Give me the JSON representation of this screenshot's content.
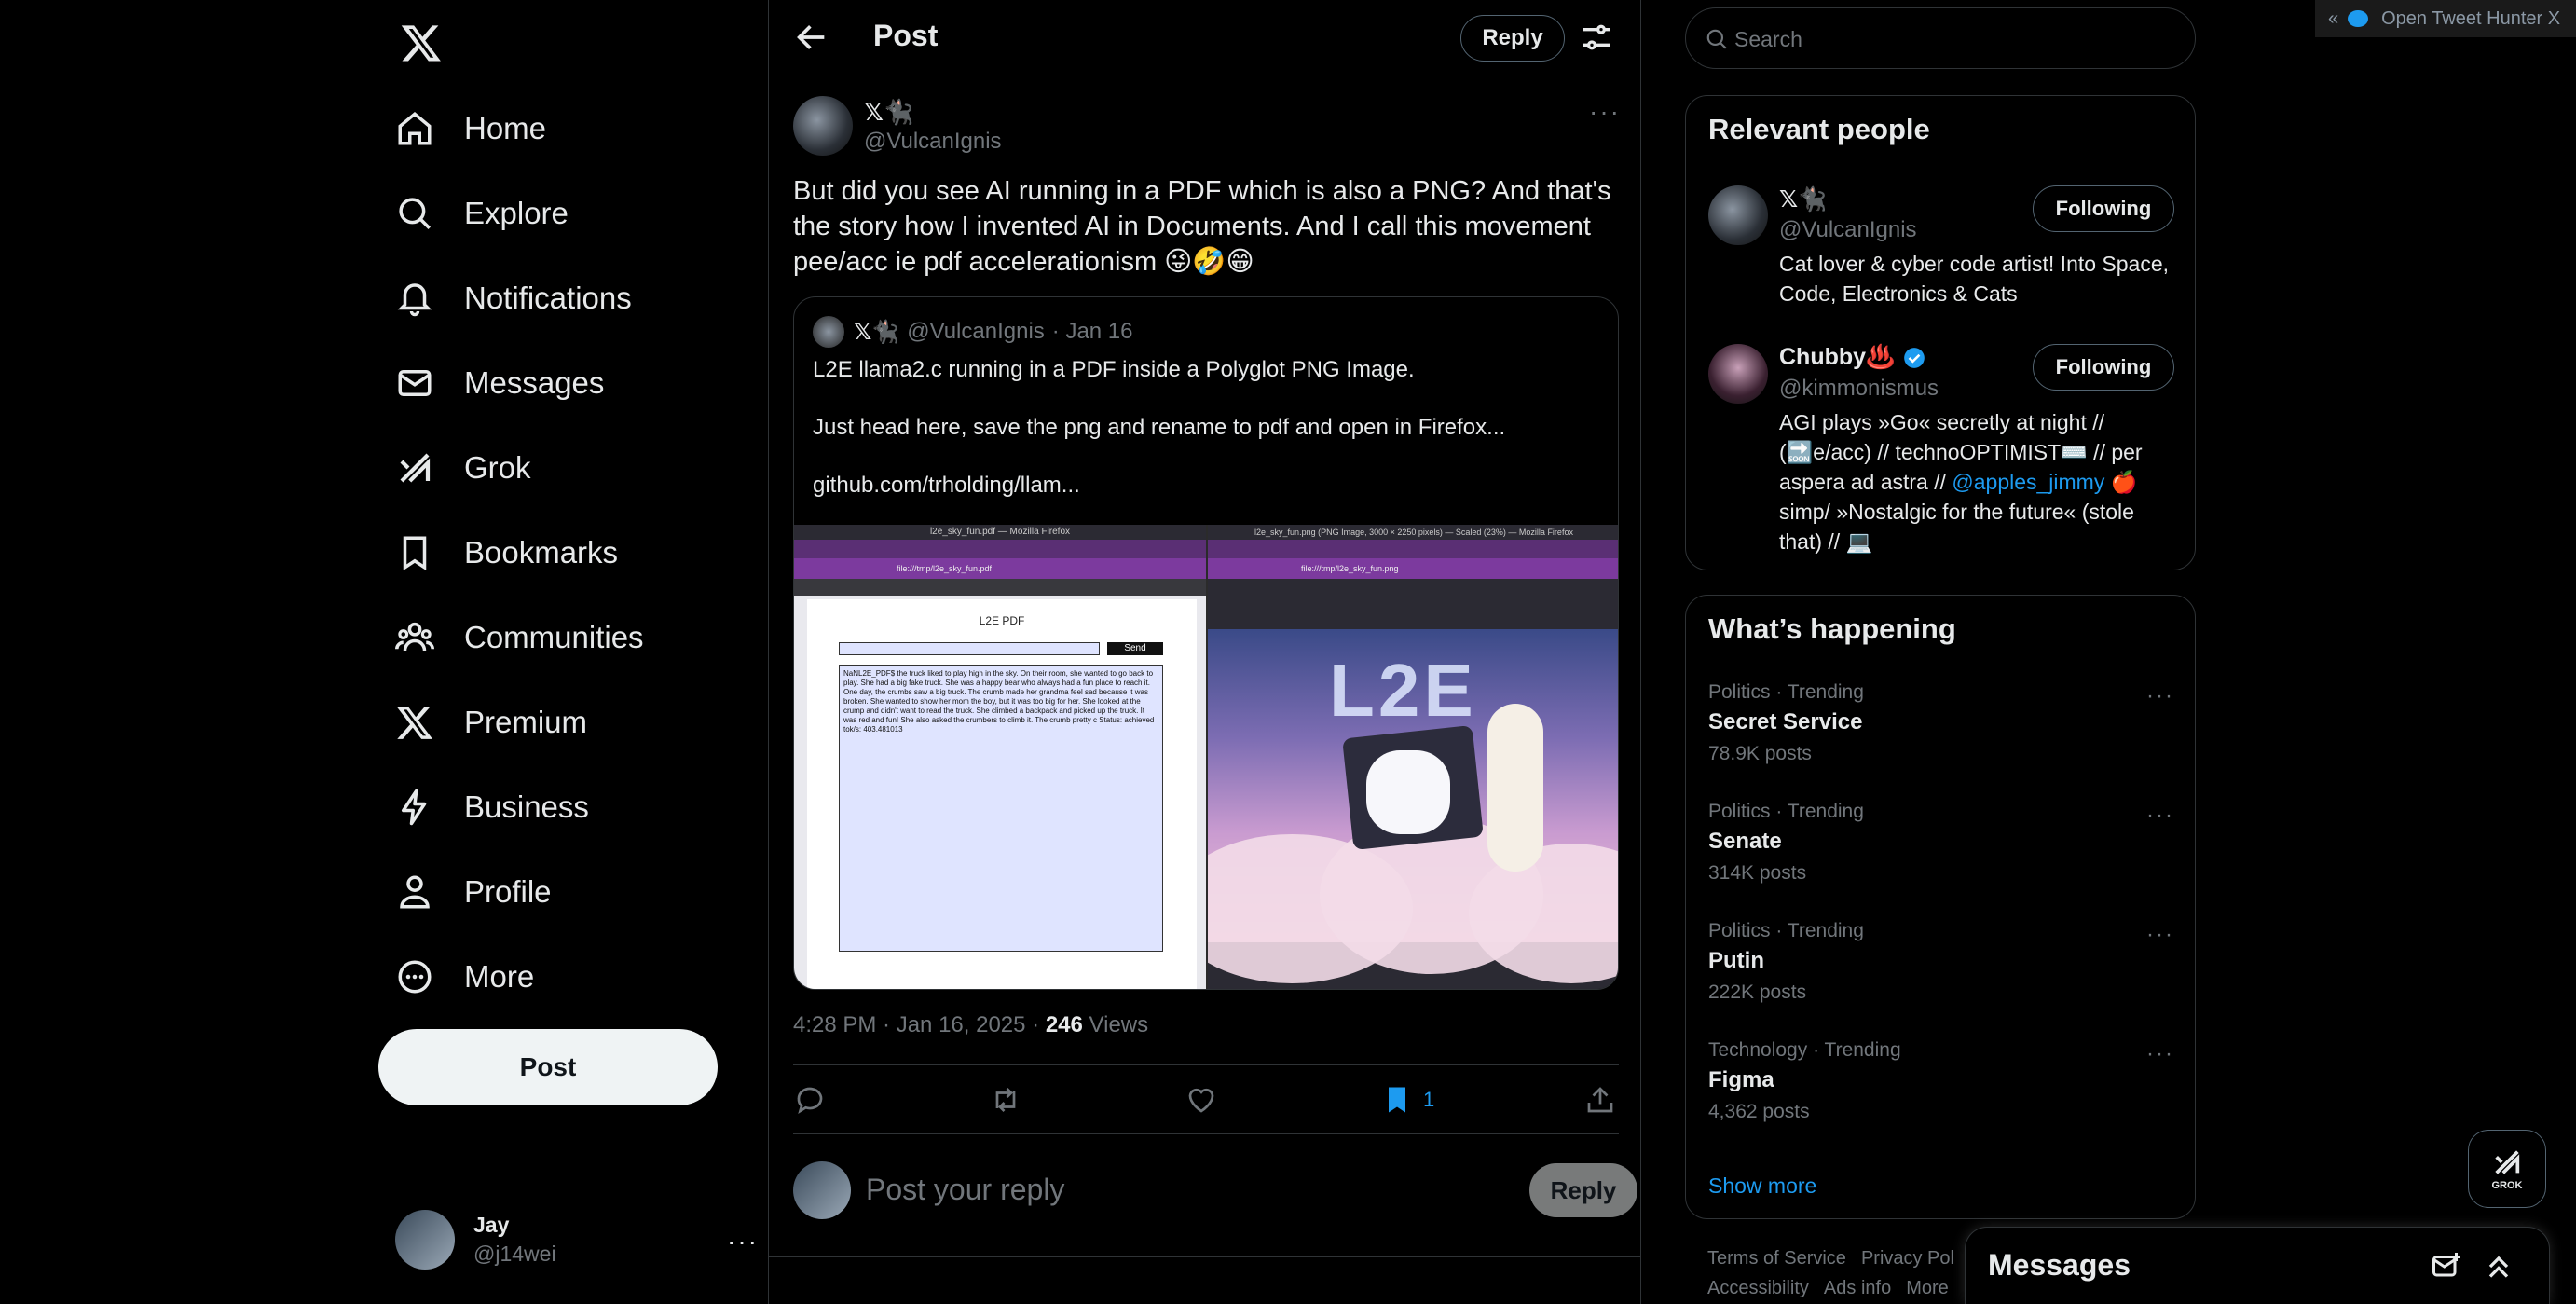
{
  "nav": {
    "items": [
      {
        "label": "Home",
        "icon": "home-icon"
      },
      {
        "label": "Explore",
        "icon": "search-icon"
      },
      {
        "label": "Notifications",
        "icon": "bell-icon"
      },
      {
        "label": "Messages",
        "icon": "mail-icon"
      },
      {
        "label": "Grok",
        "icon": "grok-icon"
      },
      {
        "label": "Bookmarks",
        "icon": "bookmark-icon"
      },
      {
        "label": "Communities",
        "icon": "communities-icon"
      },
      {
        "label": "Premium",
        "icon": "x-icon"
      },
      {
        "label": "Business",
        "icon": "lightning-icon"
      },
      {
        "label": "Profile",
        "icon": "person-icon"
      },
      {
        "label": "More",
        "icon": "more-circle-icon"
      }
    ],
    "post_label": "Post"
  },
  "account": {
    "name": "Jay",
    "handle": "@j14wei"
  },
  "header": {
    "title": "Post",
    "reply_label": "Reply"
  },
  "tweet": {
    "author_name": "𝕏🐈‍⬛",
    "author_handle": "@VulcanIgnis",
    "text": "But did you see AI running in a PDF which is also a PNG? And that's the story how I invented AI in Documents. And I call this movement pee/acc ie pdf accelerationism 😜🤣😁",
    "quote": {
      "author_name": "𝕏🐈‍⬛",
      "author_handle": "@VulcanIgnis",
      "date": "· Jan 16",
      "text": "L2E llama2.c running in a PDF inside a Polyglot PNG Image.\n\nJust head here, save the png and rename to pdf and open in Firefox...\n\ngithub.com/trholding/llam...",
      "media_left": {
        "window_title": "l2e_sky_fun.pdf — Mozilla Firefox",
        "url": "file:///tmp/l2e_sky_fun.pdf",
        "pdf_title": "L2E PDF",
        "send_label": "Send",
        "output": "NaNL2E_PDF$ the truck liked to play high in the sky. On their room, she wanted to go back to play. She had a big fake truck. She was a happy bear who always had a fun place to reach it. One day, the crumbs saw a big truck. The crumb made her grandma feel sad because it was broken. She wanted to show her mom the boy, but it was too big for her. She looked at the crump and didn't want to read the truck. She climbed a backpack and picked up the truck. It was red and fun! She also asked the crumbers to climb it. The crumb pretty c Status: achieved tok/s: 403.481013"
      },
      "media_right": {
        "window_title": "l2e_sky_fun.png (PNG Image, 3000 × 2250 pixels) — Scaled (23%) — Mozilla Firefox",
        "url": "file:///tmp/l2e_sky_fun.png",
        "image_text": "L2E"
      }
    },
    "time": "4:28 PM · Jan 16, 2025 · ",
    "views_count": "246",
    "views_label": " Views",
    "bookmark_count": "1",
    "reply_placeholder": "Post your reply",
    "reply_button": "Reply"
  },
  "sidebar": {
    "search_placeholder": "Search",
    "relevant_title": "Relevant people",
    "people": [
      {
        "name": "𝕏🐈‍⬛",
        "handle": "@VulcanIgnis",
        "bio": "Cat lover & cyber code artist! Into Space, Code, Electronics & Cats",
        "follow": "Following"
      },
      {
        "name": "Chubby♨️",
        "handle": "@kimmonismus",
        "bio_before": "AGI plays »Go« secretly at night // (🔜e/acc) // technoOPTIMIST⌨️ // per aspera ad astra // ",
        "bio_link": "@apples_jimmy",
        "bio_after": " 🍎simp/ »Nostalgic for the future« (stole that) // 💻",
        "follow": "Following"
      }
    ],
    "happening_title": "What’s happening",
    "trends": [
      {
        "category": "Politics · Trending",
        "name": "Secret Service",
        "count": "78.9K posts"
      },
      {
        "category": "Politics · Trending",
        "name": "Senate",
        "count": "314K posts"
      },
      {
        "category": "Politics · Trending",
        "name": "Putin",
        "count": "222K posts"
      },
      {
        "category": "Technology · Trending",
        "name": "Figma",
        "count": "4,362 posts"
      }
    ],
    "show_more": "Show more",
    "footer": [
      "Terms of Service",
      "Privacy Pol",
      "Accessibility",
      "Ads info",
      "More"
    ]
  },
  "extension": {
    "arrow": "«",
    "label": "Open Tweet Hunter X"
  },
  "grok_label": "GROK",
  "messages_dock": {
    "title": "Messages"
  },
  "colors": {
    "accent": "#1d9bf0",
    "background": "#000000",
    "border": "#2f3336",
    "muted": "#71767b"
  }
}
